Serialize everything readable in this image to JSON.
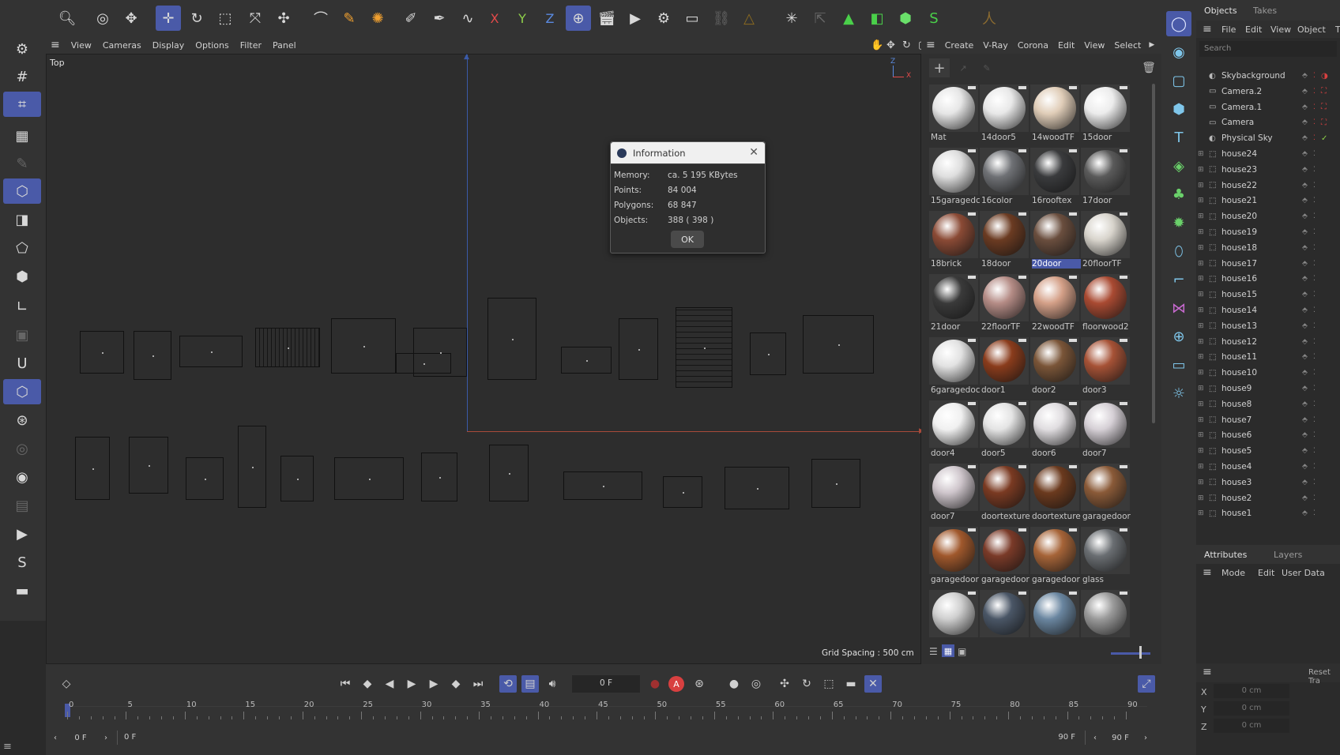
{
  "top_toolbar": {
    "icons": [
      "search-icon",
      "live-selection-icon",
      "scale-tool-icon",
      "move-tool-icon",
      "rotate-tool-icon",
      "scale-box-icon",
      "move-axis-icon",
      "snap-move-icon",
      "magnet-icon",
      "brush-icon",
      "paint-icon",
      "knife-icon",
      "spline-icon",
      "pen-icon",
      "x-axis-lock",
      "y-axis-lock",
      "z-axis-lock",
      "world-coord-icon",
      "render-region-icon",
      "render-view-icon",
      "render-settings-icon",
      "render-queue-icon",
      "link-icon",
      "deformer-icon",
      "field-icon",
      "array-icon",
      "vray-icon",
      "cube-green-icon",
      "cube-white-icon",
      "spline-green-icon",
      "character-icon"
    ],
    "x_label": "X",
    "y_label": "Y",
    "z_label": "Z"
  },
  "viewport": {
    "menu": [
      "View",
      "Cameras",
      "Display",
      "Options",
      "Filter",
      "Panel"
    ],
    "view_name": "Top",
    "grid_spacing": "Grid Spacing : 500 cm",
    "axis_y": "Z",
    "axis_x": "X"
  },
  "dialog": {
    "title": "Information",
    "rows": [
      {
        "label": "Memory:",
        "value": "ca. 5 195 KBytes"
      },
      {
        "label": "Points:",
        "value": "84 004"
      },
      {
        "label": "Polygons:",
        "value": "68 847"
      },
      {
        "label": "Objects:",
        "value": "388 ( 398 )"
      }
    ],
    "ok": "OK"
  },
  "material_panel": {
    "menu": [
      "Create",
      "V-Ray",
      "Corona",
      "Edit",
      "View",
      "Select"
    ],
    "selected": "20door",
    "materials": [
      {
        "name": "Mat",
        "color": "#e6e6e6"
      },
      {
        "name": "14door5",
        "color": "#e8e8e8"
      },
      {
        "name": "14woodTF",
        "color": "#e0cdb8"
      },
      {
        "name": "15door",
        "color": "#ececec"
      },
      {
        "name": "15garagedc",
        "color": "#dedede"
      },
      {
        "name": "16color",
        "color": "#6f7175"
      },
      {
        "name": "16rooftex",
        "color": "#3a3b3d"
      },
      {
        "name": "17door",
        "color": "#5a5a5a"
      },
      {
        "name": "18brick",
        "color": "#8a4a35"
      },
      {
        "name": "18door",
        "color": "#6b3b22"
      },
      {
        "name": "20door",
        "color": "#6a4e3e"
      },
      {
        "name": "20floorTF",
        "color": "#d8d4cc"
      },
      {
        "name": "21door",
        "color": "#3a3a3a"
      },
      {
        "name": "22floorTF",
        "color": "#b58c86"
      },
      {
        "name": "22woodTF",
        "color": "#d4a088"
      },
      {
        "name": "floorwood2",
        "color": "#a94a32"
      },
      {
        "name": "6garagedoc",
        "color": "#e2e2e2"
      },
      {
        "name": "door1",
        "color": "#8a3c1c"
      },
      {
        "name": "door2",
        "color": "#7a5538"
      },
      {
        "name": "door3",
        "color": "#a65236"
      },
      {
        "name": "door4",
        "color": "#f0f0f0"
      },
      {
        "name": "door5",
        "color": "#e4e4e4"
      },
      {
        "name": "door6",
        "color": "#e0dde0"
      },
      {
        "name": "door7",
        "color": "#d6d0d6"
      },
      {
        "name": "door7",
        "color": "#cfc6cc"
      },
      {
        "name": "doortexture",
        "color": "#7a3a22"
      },
      {
        "name": "doortexture",
        "color": "#6b3a1e"
      },
      {
        "name": "garagedoor",
        "color": "#8a5a38"
      },
      {
        "name": "garagedoor",
        "color": "#a0582c"
      },
      {
        "name": "garagedoor",
        "color": "#7a3a28"
      },
      {
        "name": "garagedoor",
        "color": "#a66438"
      },
      {
        "name": "glass",
        "color": "#6a6e72"
      },
      {
        "name": "",
        "color": "#cfcfcf"
      },
      {
        "name": "",
        "color": "#4a5666"
      },
      {
        "name": "",
        "color": "#6a86a0"
      },
      {
        "name": "",
        "color": "#9a9a9a"
      }
    ]
  },
  "objects_panel": {
    "tabs": [
      "Objects",
      "Takes"
    ],
    "menu": [
      "File",
      "Edit",
      "View",
      "Object",
      "T"
    ],
    "search_placeholder": "Search",
    "items": [
      "Skybackground",
      "Camera.2",
      "Camera.1",
      "Camera",
      "Physical Sky",
      "house24",
      "house23",
      "house22",
      "house21",
      "house20",
      "house19",
      "house18",
      "house17",
      "house16",
      "house15",
      "house14",
      "house13",
      "house12",
      "house11",
      "house10",
      "house9",
      "house8",
      "house7",
      "house6",
      "house5",
      "house4",
      "house3",
      "house2",
      "house1"
    ]
  },
  "attributes_panel": {
    "tabs": [
      "Attributes",
      "Layers"
    ],
    "menu": [
      "Mode",
      "Edit",
      "User Data"
    ],
    "reset": "Reset Tra",
    "fields": [
      {
        "axis": "X",
        "value": "0 cm"
      },
      {
        "axis": "Y",
        "value": "0 cm"
      },
      {
        "axis": "Z",
        "value": "0 cm"
      }
    ]
  },
  "timeline": {
    "current_frame": "0 F",
    "ticks": [
      "0",
      "5",
      "10",
      "15",
      "20",
      "25",
      "30",
      "35",
      "40",
      "45",
      "50",
      "55",
      "60",
      "65",
      "70",
      "75",
      "80",
      "85",
      "90"
    ],
    "start_field": "0 F",
    "range_start": "0 F",
    "range_end": "90 F",
    "end_field": "90 F",
    "record_label": "A"
  }
}
